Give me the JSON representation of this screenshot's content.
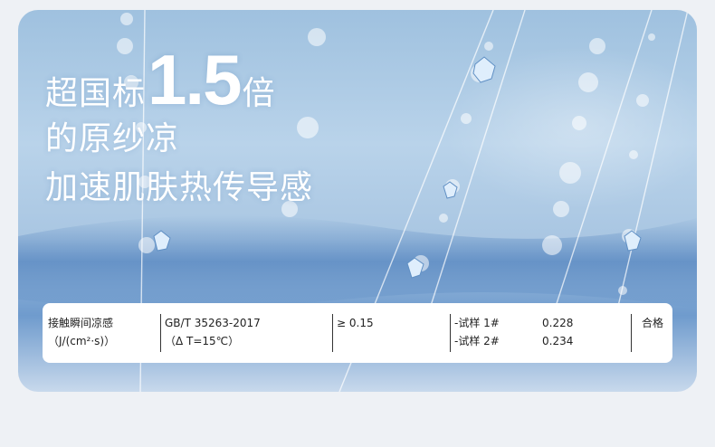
{
  "headline": {
    "line1_prefix": "超国标",
    "line1_number": "1.5",
    "line1_suffix": "倍",
    "line2": "的原纱凉",
    "line3": "加速肌肤热传导感"
  },
  "spec_table": {
    "item_name": "接触瞬间凉感",
    "item_unit": "（J/(cm²·s)）",
    "standard": "GB/T 35263-2017",
    "condition": "（Δ T=15℃）",
    "requirement": "≥ 0.15",
    "samples": [
      {
        "label": "-试样 1#",
        "value": "0.228"
      },
      {
        "label": "-试样 2#",
        "value": "0.234"
      }
    ],
    "result": "合格"
  },
  "colors": {
    "page_bg": "#eef1f5",
    "text_white": "#ffffff",
    "table_bg": "#ffffff"
  }
}
